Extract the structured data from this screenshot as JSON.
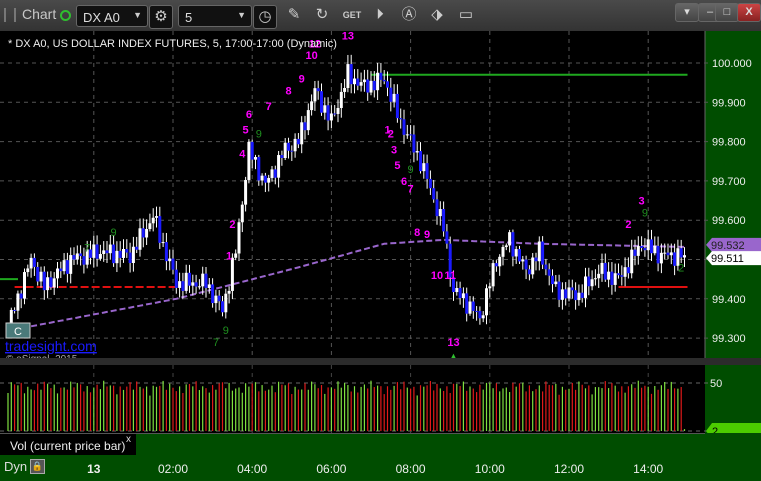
{
  "toolbar": {
    "title": "Chart",
    "symbol": "DX A0",
    "interval": "5",
    "icons": [
      "gear-icon",
      "clock-icon",
      "pencil-icon",
      "refresh-icon",
      "get-icon",
      "play-icon",
      "alert-icon",
      "link-icon",
      "comment-icon"
    ],
    "window_buttons": [
      "restore-icon",
      "minimize-icon",
      "maximize-icon",
      "close-icon"
    ],
    "close_glyph": "X"
  },
  "chart": {
    "caption": "* DX A0, US DOLLAR INDEX FUTURES, 5, 17:00-17:00 (Dynamic)",
    "watermark": "tradesight.com",
    "copyright": "© eSignal, 2015",
    "c_marker": "C",
    "colors": {
      "up": "#ffffff",
      "down": "#1a1aff",
      "axis_bg": "#004d00",
      "ma": "#9966cc",
      "magenta": "#ff00ff",
      "green_count": "#1f8f1f",
      "resistance": "#1fa81f",
      "support": "#e01010"
    },
    "price_ticks": [
      "100.000",
      "99.900",
      "99.800",
      "99.700",
      "99.600",
      "99.400",
      "99.300"
    ],
    "price_tick_values": [
      100.0,
      99.9,
      99.8,
      99.7,
      99.6,
      99.5,
      99.4,
      99.3
    ],
    "ma_tag": "99.532",
    "last_tag": "99.511"
  },
  "chart_data": {
    "type": "candlestick",
    "interval_minutes": 5,
    "close_path": [
      [
        "21:50",
        99.33
      ],
      [
        "22:25",
        99.5
      ],
      [
        "22:45",
        99.43
      ],
      [
        "23:25",
        99.5
      ],
      [
        "00:10",
        99.52
      ],
      [
        "00:55",
        99.51
      ],
      [
        "01:30",
        99.61
      ],
      [
        "02:05",
        99.44
      ],
      [
        "02:50",
        99.44
      ],
      [
        "03:15",
        99.37
      ],
      [
        "03:35",
        99.52
      ],
      [
        "03:55",
        99.78
      ],
      [
        "04:20",
        99.69
      ],
      [
        "04:50",
        99.78
      ],
      [
        "05:10",
        99.8
      ],
      [
        "05:35",
        99.93
      ],
      [
        "06:00",
        99.85
      ],
      [
        "06:25",
        99.97
      ],
      [
        "06:50",
        99.94
      ],
      [
        "07:20",
        99.96
      ],
      [
        "07:45",
        99.85
      ],
      [
        "08:15",
        99.75
      ],
      [
        "08:30",
        99.68
      ],
      [
        "08:50",
        99.58
      ],
      [
        "09:05",
        99.42
      ],
      [
        "09:20",
        99.4
      ],
      [
        "09:45",
        99.35
      ],
      [
        "10:10",
        99.5
      ],
      [
        "10:30",
        99.55
      ],
      [
        "10:55",
        99.47
      ],
      [
        "11:15",
        99.52
      ],
      [
        "11:40",
        99.42
      ],
      [
        "12:15",
        99.41
      ],
      [
        "12:45",
        99.47
      ],
      [
        "13:15",
        99.45
      ],
      [
        "13:50",
        99.54
      ],
      [
        "14:20",
        99.51
      ],
      [
        "14:55",
        99.511
      ]
    ],
    "moving_average": [
      [
        "22:25",
        99.33
      ],
      [
        "02:05",
        99.4
      ],
      [
        "05:10",
        99.48
      ],
      [
        "07:20",
        99.54
      ],
      [
        "08:50",
        99.55
      ],
      [
        "11:15",
        99.54
      ],
      [
        "14:55",
        99.532
      ]
    ],
    "levels": [
      {
        "kind": "resistance",
        "price": 99.97,
        "from": "07:00",
        "to": "14:55"
      },
      {
        "kind": "support",
        "price": 99.43,
        "from": "22:00",
        "to": "02:05"
      },
      {
        "kind": "support",
        "price": 99.43,
        "from": "13:15",
        "to": "14:55"
      }
    ],
    "annotations": [
      {
        "text": "13",
        "t": "06:25",
        "p": 100.06,
        "c": "magenta"
      },
      {
        "text": "12",
        "t": "05:35",
        "p": 100.04,
        "c": "magenta"
      },
      {
        "text": "10",
        "t": "05:30",
        "p": 100.01,
        "c": "magenta"
      },
      {
        "text": "9",
        "t": "05:15",
        "p": 99.95,
        "c": "magenta"
      },
      {
        "text": "8",
        "t": "04:55",
        "p": 99.92,
        "c": "magenta"
      },
      {
        "text": "7",
        "t": "04:25",
        "p": 99.88,
        "c": "magenta"
      },
      {
        "text": "6",
        "t": "03:55",
        "p": 99.86,
        "c": "magenta"
      },
      {
        "text": "5",
        "t": "03:50",
        "p": 99.82,
        "c": "magenta"
      },
      {
        "text": "4",
        "t": "03:45",
        "p": 99.76,
        "c": "magenta"
      },
      {
        "text": "2",
        "t": "03:30",
        "p": 99.58,
        "c": "magenta"
      },
      {
        "text": "1",
        "t": "03:25",
        "p": 99.5,
        "c": "magenta"
      },
      {
        "text": "1",
        "t": "07:25",
        "p": 99.82,
        "c": "magenta"
      },
      {
        "text": "2",
        "t": "07:30",
        "p": 99.81,
        "c": "magenta"
      },
      {
        "text": "3",
        "t": "07:35",
        "p": 99.77,
        "c": "magenta"
      },
      {
        "text": "5",
        "t": "07:40",
        "p": 99.73,
        "c": "magenta"
      },
      {
        "text": "6",
        "t": "07:50",
        "p": 99.69,
        "c": "magenta"
      },
      {
        "text": "7",
        "t": "08:00",
        "p": 99.67,
        "c": "magenta"
      },
      {
        "text": "8",
        "t": "08:10",
        "p": 99.56,
        "c": "magenta"
      },
      {
        "text": "9",
        "t": "08:25",
        "p": 99.555,
        "c": "magenta"
      },
      {
        "text": "10",
        "t": "08:40",
        "p": 99.45,
        "c": "magenta"
      },
      {
        "text": "11",
        "t": "09:00",
        "p": 99.45,
        "c": "magenta"
      },
      {
        "text": "13",
        "t": "09:05",
        "p": 99.28,
        "c": "magenta"
      },
      {
        "text": "3",
        "t": "13:50",
        "p": 99.64,
        "c": "magenta"
      },
      {
        "text": "2",
        "t": "13:30",
        "p": 99.58,
        "c": "magenta"
      },
      {
        "text": "7",
        "t": "23:50",
        "p": 99.52,
        "c": "green"
      },
      {
        "text": "9",
        "t": "00:30",
        "p": 99.56,
        "c": "green"
      },
      {
        "text": "9",
        "t": "04:10",
        "p": 99.81,
        "c": "green"
      },
      {
        "text": "9",
        "t": "08:00",
        "p": 99.72,
        "c": "green"
      },
      {
        "text": "9",
        "t": "13:55",
        "p": 99.61,
        "c": "green"
      },
      {
        "text": "2",
        "t": "14:50",
        "p": 99.47,
        "c": "green"
      },
      {
        "text": "7",
        "t": "03:05",
        "p": 99.28,
        "c": "green"
      },
      {
        "text": "9",
        "t": "03:20",
        "p": 99.31,
        "c": "green"
      }
    ]
  },
  "volume": {
    "label": "Vol (current price bar)",
    "close_glyph": "x",
    "tick": "50",
    "last_tag": "2"
  },
  "time_axis": {
    "dyn_label": "Dyn",
    "labels": [
      {
        "text": "13",
        "t": "00:00"
      },
      {
        "text": "02:00",
        "t": "02:00"
      },
      {
        "text": "04:00",
        "t": "04:00"
      },
      {
        "text": "06:00",
        "t": "06:00"
      },
      {
        "text": "08:00",
        "t": "08:00"
      },
      {
        "text": "10:00",
        "t": "10:00"
      },
      {
        "text": "12:00",
        "t": "12:00"
      },
      {
        "text": "14:00",
        "t": "14:00"
      }
    ]
  }
}
